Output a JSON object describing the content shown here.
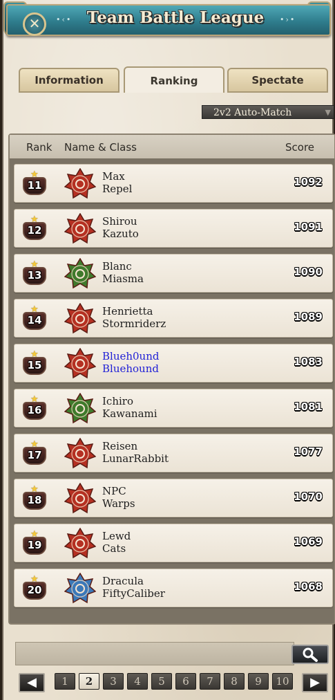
{
  "window": {
    "title": "Team Battle League",
    "close_glyph": "✕"
  },
  "tabs": [
    {
      "label": "Information",
      "active": false
    },
    {
      "label": "Ranking",
      "active": true
    },
    {
      "label": "Spectate",
      "active": false
    }
  ],
  "mode_select": {
    "value": "2v2 Auto-Match",
    "arrow_icon": "triangle-down-icon"
  },
  "table": {
    "headers": {
      "rank": "Rank",
      "name_class": "Name & Class",
      "score": "Score"
    },
    "rows": [
      {
        "rank": "11",
        "name": "Max",
        "cls": "Repel",
        "score": "1092",
        "icon": "red-star-sigil-icon",
        "color": "#b53022",
        "highlight": false
      },
      {
        "rank": "12",
        "name": "Shirou",
        "cls": "Kazuto",
        "score": "1091",
        "icon": "red-dragon-sigil-icon",
        "color": "#b53022",
        "highlight": false
      },
      {
        "rank": "13",
        "name": "Blanc",
        "cls": "Miasma",
        "score": "1090",
        "icon": "green-hexagram-sigil-icon",
        "color": "#3f7a2c",
        "highlight": false
      },
      {
        "rank": "14",
        "name": "Henrietta",
        "cls": "Stormriderz",
        "score": "1089",
        "icon": "red-winged-sword-sigil-icon",
        "color": "#b53022",
        "highlight": false
      },
      {
        "rank": "15",
        "name": "Blueh0und",
        "cls": "Bluehound",
        "score": "1083",
        "icon": "red-dragon-sigil-icon",
        "color": "#b53022",
        "highlight": true
      },
      {
        "rank": "16",
        "name": "Ichiro",
        "cls": "Kawanami",
        "score": "1081",
        "icon": "green-hatted-figure-sigil-icon",
        "color": "#3f7a2c",
        "highlight": false
      },
      {
        "rank": "17",
        "name": "Reisen",
        "cls": "LunarRabbit",
        "score": "1077",
        "icon": "red-dragon-sigil-icon",
        "color": "#b53022",
        "highlight": false
      },
      {
        "rank": "18",
        "name": "NPC",
        "cls": "Warps",
        "score": "1070",
        "icon": "red-bomb-sigil-icon",
        "color": "#b53022",
        "highlight": false
      },
      {
        "rank": "19",
        "name": "Lewd",
        "cls": "Cats",
        "score": "1069",
        "icon": "red-horseshoe-sigil-icon",
        "color": "#b53022",
        "highlight": false
      },
      {
        "rank": "20",
        "name": "Dracula",
        "cls": "FiftyCaliber",
        "score": "1068",
        "icon": "blue-snowflake-sigil-icon",
        "color": "#3b78b8",
        "highlight": false
      }
    ]
  },
  "search": {
    "value": "",
    "icon": "magnifier-icon"
  },
  "pagination": {
    "prev_icon": "arrow-left-icon",
    "next_icon": "arrow-right-icon",
    "pages": [
      "1",
      "2",
      "3",
      "4",
      "5",
      "6",
      "7",
      "8",
      "9",
      "10"
    ],
    "current": "2"
  }
}
